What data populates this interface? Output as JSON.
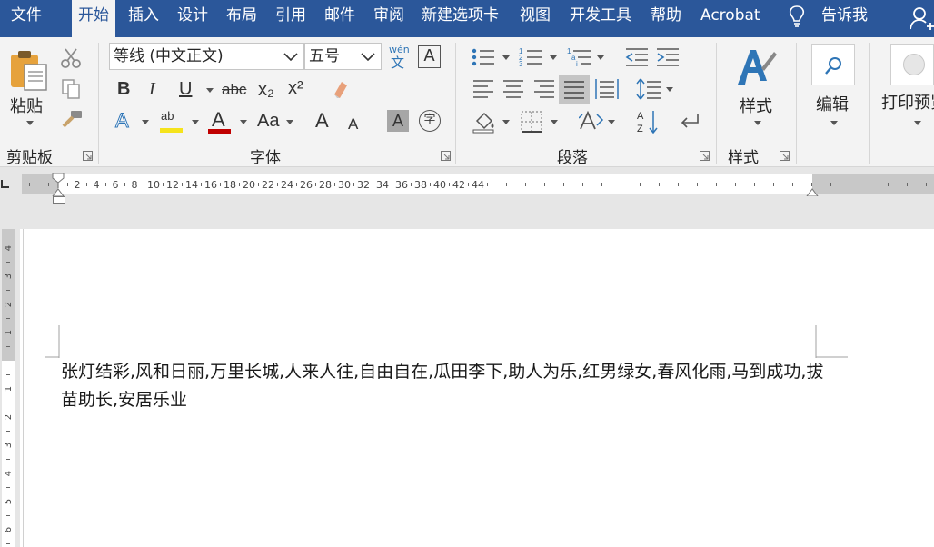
{
  "tabs": {
    "file": "文件",
    "home": "开始",
    "insert": "插入",
    "design": "设计",
    "layout": "布局",
    "references": "引用",
    "mailings": "邮件",
    "review": "审阅",
    "new_tab": "新建选项卡",
    "view": "视图",
    "developer": "开发工具",
    "help": "帮助",
    "acrobat": "Acrobat",
    "tell_me": "告诉我"
  },
  "clipboard": {
    "paste_label": "粘贴",
    "group_label": "剪贴板"
  },
  "font": {
    "font_name": "等线 (中文正文)",
    "font_size": "五号",
    "phonetic_top": "wén",
    "phonetic_bottom": "文",
    "bold": "B",
    "italic": "I",
    "underline": "U",
    "strike": "abc",
    "subscript": "x₂",
    "superscript": "x²",
    "font_color_letter": "A",
    "change_case": "Aa",
    "grow": "A",
    "shrink": "A",
    "shade_letter": "A",
    "enclose": "字",
    "group_label": "字体",
    "colors": {
      "highlight": "#f5e31b",
      "font_color": "#c00000"
    }
  },
  "paragraph": {
    "group_label": "段落"
  },
  "styles": {
    "label": "样式",
    "group_label": "样式"
  },
  "editing": {
    "label": "编辑"
  },
  "print_preview": {
    "label": "打印预览"
  },
  "ruler": {
    "h_numbers": [
      "2",
      "4",
      "6",
      "8",
      "10",
      "12",
      "14",
      "16",
      "18",
      "20",
      "22",
      "24",
      "26",
      "28",
      "30",
      "32",
      "34",
      "36",
      "38",
      "40",
      "42",
      "44"
    ],
    "v_numbers_top": [
      "4",
      "3",
      "2",
      "1"
    ],
    "v_numbers_body": [
      "1",
      "2",
      "3",
      "4",
      "5",
      "6"
    ]
  },
  "document": {
    "text": "张灯结彩,风和日丽,万里长城,人来人往,自由自在,瓜田李下,助人为乐,红男绿女,春风化雨,马到成功,拔苗助长,安居乐业"
  },
  "colors": {
    "accent": "#2b579a",
    "ribbon_bg": "#f3f3f3",
    "icon_blue": "#2e75b6"
  }
}
